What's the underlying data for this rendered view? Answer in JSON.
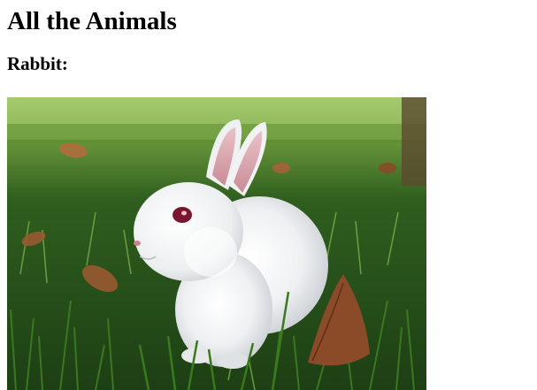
{
  "page": {
    "heading": "All the Animals",
    "subheading": "Rabbit:"
  },
  "image": {
    "subject": "white rabbit sitting in green grass with fallen leaves"
  }
}
